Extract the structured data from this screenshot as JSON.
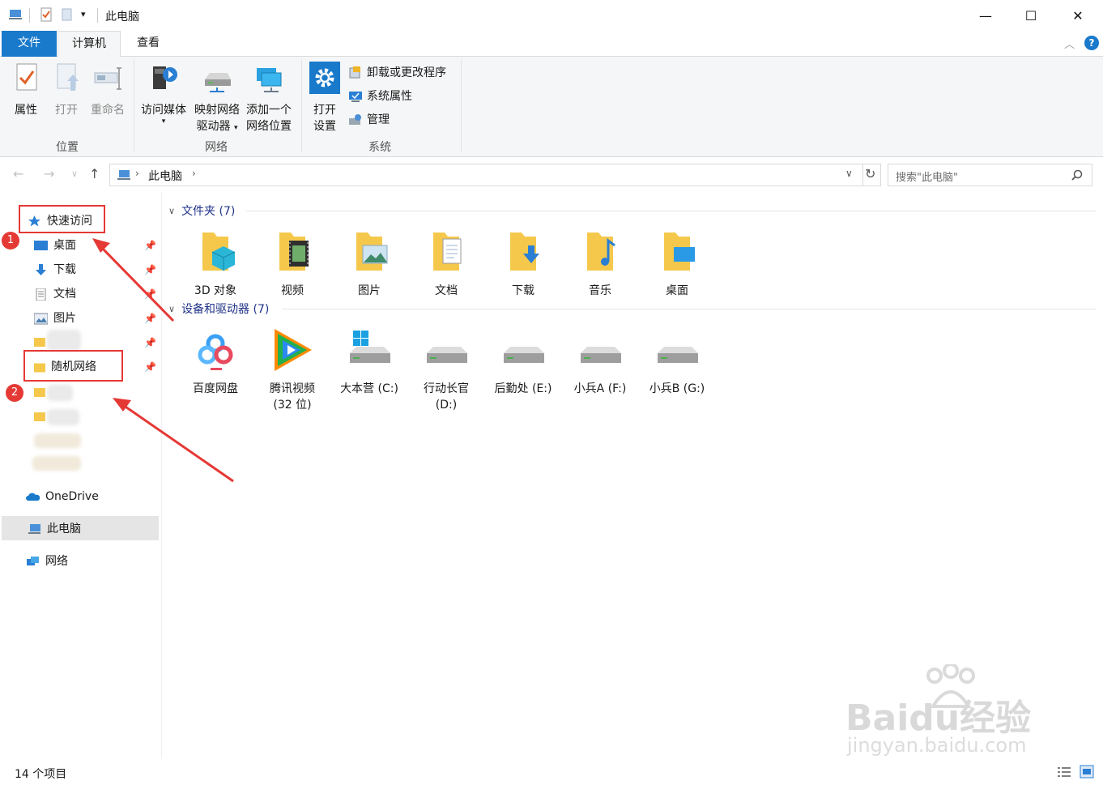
{
  "window": {
    "title": "此电脑",
    "minimize": "—",
    "maximize": "☐",
    "close": "✕"
  },
  "ribbon": {
    "tabs": [
      "文件",
      "计算机",
      "查看"
    ],
    "help": "?",
    "groups": {
      "location": {
        "label": "位置",
        "properties": "属性",
        "open": "打开",
        "rename": "重命名"
      },
      "network": {
        "label": "网络",
        "access_media": "访问媒体",
        "map_drive_l1": "映射网络",
        "map_drive_l2": "驱动器",
        "add_location_l1": "添加一个",
        "add_location_l2": "网络位置"
      },
      "system": {
        "label": "系统",
        "open_settings_l1": "打开",
        "open_settings_l2": "设置",
        "uninstall": "卸载或更改程序",
        "system_properties": "系统属性",
        "manage": "管理"
      }
    }
  },
  "address": {
    "path": "此电脑",
    "search_placeholder": "搜索\"此电脑\""
  },
  "nav": {
    "quick_access": "快速访问",
    "items": [
      {
        "label": "桌面",
        "icon": "desktop-icon"
      },
      {
        "label": "下载",
        "icon": "download-icon"
      },
      {
        "label": "文档",
        "icon": "document-icon"
      },
      {
        "label": "图片",
        "icon": "picture-icon"
      }
    ],
    "random_network": "随机网络",
    "onedrive": "OneDrive",
    "this_pc": "此电脑",
    "network": "网络"
  },
  "content": {
    "folders_header": "文件夹 (7)",
    "folders": [
      {
        "label": "3D 对象",
        "icon": "3d-objects-folder-icon"
      },
      {
        "label": "视频",
        "icon": "videos-folder-icon"
      },
      {
        "label": "图片",
        "icon": "pictures-folder-icon"
      },
      {
        "label": "文档",
        "icon": "documents-folder-icon"
      },
      {
        "label": "下载",
        "icon": "downloads-folder-icon"
      },
      {
        "label": "音乐",
        "icon": "music-folder-icon"
      },
      {
        "label": "桌面",
        "icon": "desktop-folder-icon"
      }
    ],
    "devices_header": "设备和驱动器 (7)",
    "devices": [
      {
        "label": "百度网盘",
        "icon": "baidu-netdisk-icon"
      },
      {
        "label": "腾讯视频\n(32 位)",
        "icon": "tencent-video-icon"
      },
      {
        "label": "大本营 (C:)",
        "icon": "system-drive-icon"
      },
      {
        "label": "行动长官\n(D:)",
        "icon": "drive-icon"
      },
      {
        "label": "后勤处 (E:)",
        "icon": "drive-icon"
      },
      {
        "label": "小兵A (F:)",
        "icon": "drive-icon"
      },
      {
        "label": "小兵B (G:)",
        "icon": "drive-icon"
      }
    ]
  },
  "status": {
    "item_count": "14 个项目"
  },
  "annotations": {
    "badge1": "1",
    "badge2": "2",
    "accent": "#e53935"
  },
  "watermark": {
    "main": "Baidu经验",
    "sub": "jingyan.baidu.com"
  }
}
